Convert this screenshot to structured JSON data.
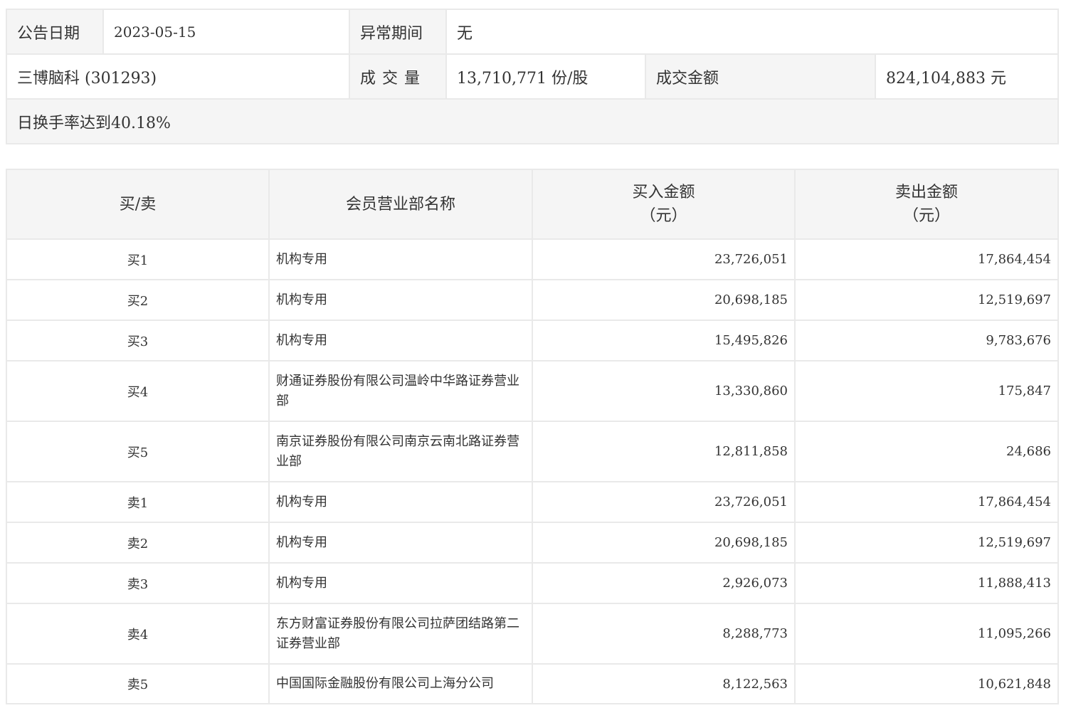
{
  "summary": {
    "announce_date_label": "公告日期",
    "announce_date_value": "2023-05-15",
    "abnormal_period_label": "异常期间",
    "abnormal_period_value": "无",
    "stock_name": "三博脑科 (301293)",
    "volume_label": "成交量",
    "volume_value": "13,710,771 份/股",
    "turnover_label": "成交金额",
    "turnover_value": "824,104,883 元",
    "note": "日换手率达到40.18%"
  },
  "detail": {
    "headers": {
      "side": "买/卖",
      "dept": "会员营业部名称",
      "buy": "买入金额",
      "buy_unit": "（元）",
      "sell": "卖出金额",
      "sell_unit": "（元）"
    },
    "rows": [
      {
        "side": "买1",
        "dept": "机构专用",
        "buy": "23,726,051",
        "sell": "17,864,454"
      },
      {
        "side": "买2",
        "dept": "机构专用",
        "buy": "20,698,185",
        "sell": "12,519,697"
      },
      {
        "side": "买3",
        "dept": "机构专用",
        "buy": "15,495,826",
        "sell": "9,783,676"
      },
      {
        "side": "买4",
        "dept": "财通证券股份有限公司温岭中华路证券营业部",
        "buy": "13,330,860",
        "sell": "175,847"
      },
      {
        "side": "买5",
        "dept": "南京证券股份有限公司南京云南北路证券营业部",
        "buy": "12,811,858",
        "sell": "24,686"
      },
      {
        "side": "卖1",
        "dept": "机构专用",
        "buy": "23,726,051",
        "sell": "17,864,454"
      },
      {
        "side": "卖2",
        "dept": "机构专用",
        "buy": "20,698,185",
        "sell": "12,519,697"
      },
      {
        "side": "卖3",
        "dept": "机构专用",
        "buy": "2,926,073",
        "sell": "11,888,413"
      },
      {
        "side": "卖4",
        "dept": "东方财富证券股份有限公司拉萨团结路第二证券营业部",
        "buy": "8,288,773",
        "sell": "11,095,266"
      },
      {
        "side": "卖5",
        "dept": "中国国际金融股份有限公司上海分公司",
        "buy": "8,122,563",
        "sell": "10,621,848"
      }
    ]
  }
}
